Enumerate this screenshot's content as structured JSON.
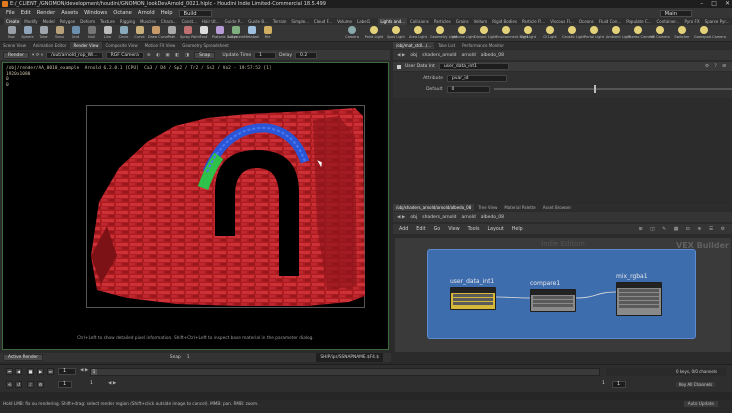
{
  "window": {
    "title": "E:/_CLIENT_/GNOMON/development/houdini/GNOMON_lookDevArnold_0021.hiplc - Houdini Indie Limited-Commercial 18.5.499",
    "controls": [
      "–",
      "□",
      "✕"
    ]
  },
  "menubar": {
    "items": [
      "File",
      "Edit",
      "Render",
      "Assets",
      "Windows",
      "Octane",
      "Arnold",
      "Help"
    ],
    "desktop": "Build",
    "context": "Main"
  },
  "shelf_tabs": {
    "left": [
      "Create",
      "Modify",
      "Model",
      "Polygon",
      "Deform",
      "Texture",
      "Rigging",
      "Muscles",
      "Chara...",
      "Const...",
      "Hair Ut...",
      "Guide P...",
      "Guide B...",
      "Terrain",
      "Simple...",
      "Cloud F...",
      "Volume",
      "Label1"
    ],
    "right": [
      "Lights and...",
      "Collisions",
      "Particles",
      "Grains",
      "Vellum",
      "Rigid Bodies",
      "Particle Fl...",
      "Viscous Fl...",
      "Oceans",
      "Fluid Con...",
      "Populate C...",
      "Container...",
      "Pyro FX",
      "Sparse Pyr...",
      "FEM",
      "Wires",
      "Crowds",
      "Drive Sim..."
    ]
  },
  "shelf_tools": {
    "left": [
      "Box",
      "Sphere",
      "Tube",
      "Torus",
      "Grid",
      "Null",
      "Line",
      "Circle",
      "Curve",
      "Draw Curve",
      "Path",
      "Spray Paint",
      "Font",
      "Platonic Solids",
      "L-System",
      "Metaball",
      "File"
    ],
    "right": [
      "Camera",
      "Point Light",
      "Spot Light",
      "Area Light",
      "Geometry Light",
      "Volume Light",
      "Distant Light",
      "Environment Light",
      "Sky Light",
      "GI Light",
      "Caustic Light",
      "Portal Light",
      "Ambient Light",
      "Stereo Camera",
      "VR Camera",
      "Switcher",
      "Gamepad Camera"
    ]
  },
  "left_pane_tabs": [
    "Scene View",
    "Animation Editor",
    "Render View",
    "Composite View",
    "Motion FX View",
    "Geometry Spreadsheet"
  ],
  "render_toolbar": {
    "render_label": "Render",
    "rop": "/out/arnold_rop_Wi...",
    "camera": "RGF Camera",
    "snap_label": "Snap",
    "update_time_label": "Update Time",
    "update_time": "1",
    "delay_label": "Delay",
    "delay": "0.2"
  },
  "viewport": {
    "info_lines": [
      "/obj/render/AA_0010_example  Arnold 6.2.0.1 [CPU]  Ca3 / D4 / Sp2 / Tr2 / Ss2 / Vo2 - 19:57:52 [1]",
      "1920x1080",
      "0",
      "0"
    ],
    "hint": "Ctrl+Left to show detailed pixel information. Shift+Ctrl+Left to inspect base material in the parameter dialog."
  },
  "left_bottom": {
    "tab": "Active Render",
    "snap_label": "Snap",
    "snap_value": "1",
    "path": "SHIP/ipr/SSNAPNAME.$F4.$"
  },
  "params_panel": {
    "tabs": [
      "/obj/mat_stdl.../...",
      "Take List",
      "Performance Monitor"
    ],
    "path": [
      "obj",
      "shaders_arnold",
      "arnold",
      "albedo_08"
    ],
    "node_type": "User Data Int",
    "node_name": "user_data_int1",
    "attribute_label": "Attribute",
    "attribute_value": "pvar_id",
    "default_label": "Default",
    "default_value": "0",
    "default_fraction": 0.42
  },
  "network_panel": {
    "tabs": [
      "/obj/shaders_arnold/arnold/albedo_08",
      "Tree View",
      "Material Palette",
      "Asset Browser"
    ],
    "path": [
      "obj",
      "shaders_arnold",
      "arnold",
      "albedo_08"
    ],
    "menu": [
      "Add",
      "Edit",
      "Go",
      "View",
      "Tools",
      "Layout",
      "Help"
    ],
    "watermark_title": "Indie Edition",
    "builder_label": "VEX Builder",
    "nodes": [
      {
        "label": "user_data_int1",
        "selected": true
      },
      {
        "label": "compare1",
        "selected": false
      },
      {
        "label": "mix_rgba1",
        "selected": false
      }
    ]
  },
  "timeline": {
    "frame": "1",
    "start": "1",
    "end": "1",
    "range_start": "1",
    "range_end": "1",
    "keys_label": "0 keys, 0/0 channels",
    "key_all_label": "Key All Channels",
    "auto_update": "Auto Update"
  },
  "status": {
    "text": "Hold LMB: fix ou rendering. Shift+drag: select render region (Shift+click outside image to cancel). MMB: pan. RMB: zoom."
  },
  "colors": {
    "render_red": "#c4242a",
    "arch_blue": "#2a55d6",
    "arch_green": "#2ec24a",
    "node_selected": "#d6b93a",
    "network_box": "#3e6dae"
  }
}
